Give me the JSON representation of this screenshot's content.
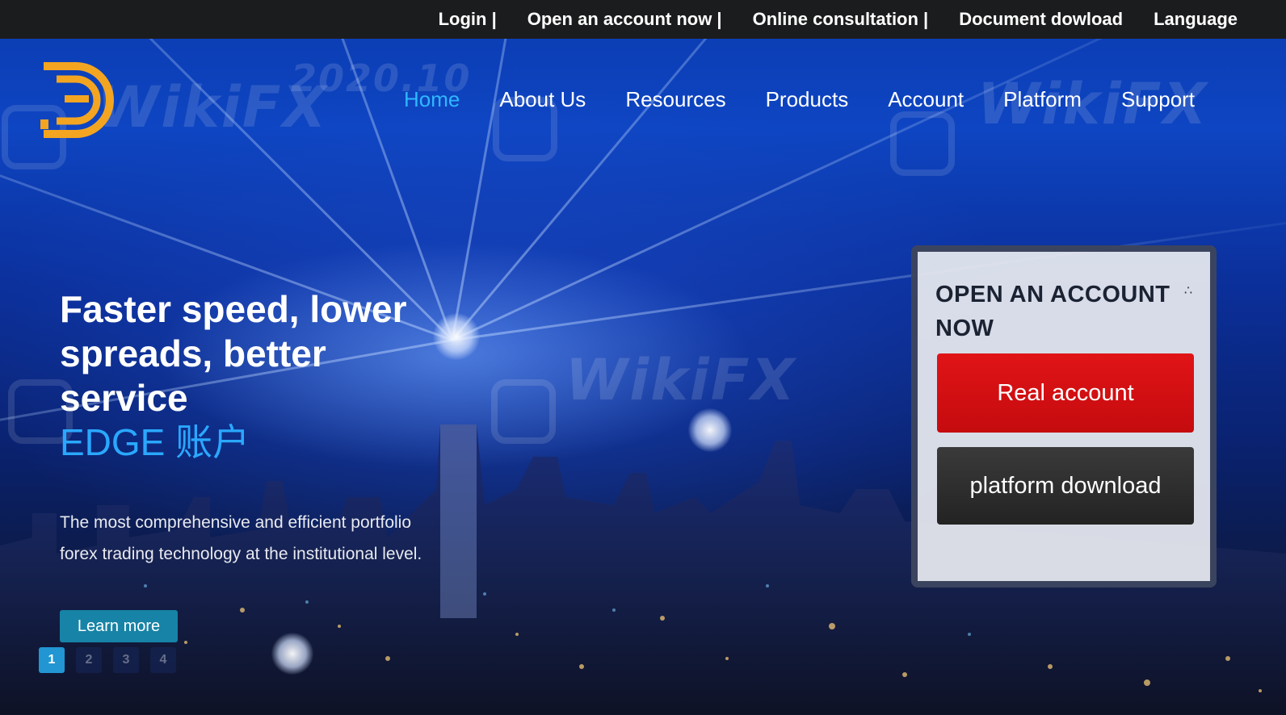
{
  "topbar": {
    "links": [
      "Login |",
      "Open an account now |",
      "Online consultation |",
      "Document dowload",
      "Language"
    ]
  },
  "nav": {
    "items": [
      "Home",
      "About Us",
      "Resources",
      "Products",
      "Account",
      "Platform",
      "Support"
    ]
  },
  "hero": {
    "headline": "Faster speed, lower spreads, better service",
    "subhead": "EDGE 账户",
    "description": "The most comprehensive and efficient portfolio forex trading technology at the institutional level.",
    "learn_more": "Learn more",
    "pager": [
      "1",
      "2",
      "3",
      "4"
    ]
  },
  "account_card": {
    "title": "OPEN AN ACCOUNT NOW",
    "real_account": "Real account",
    "platform_download": "platform download"
  },
  "watermark": {
    "brand": "WikiFX",
    "date": "2020.10"
  },
  "colors": {
    "topbar": "#1b1c1e",
    "nav_active": "#2fb7ff",
    "real_button": "#d01013",
    "platform_button": "#2c2c2c",
    "learn_button": "#1783a6",
    "logo": "#f3a521"
  }
}
